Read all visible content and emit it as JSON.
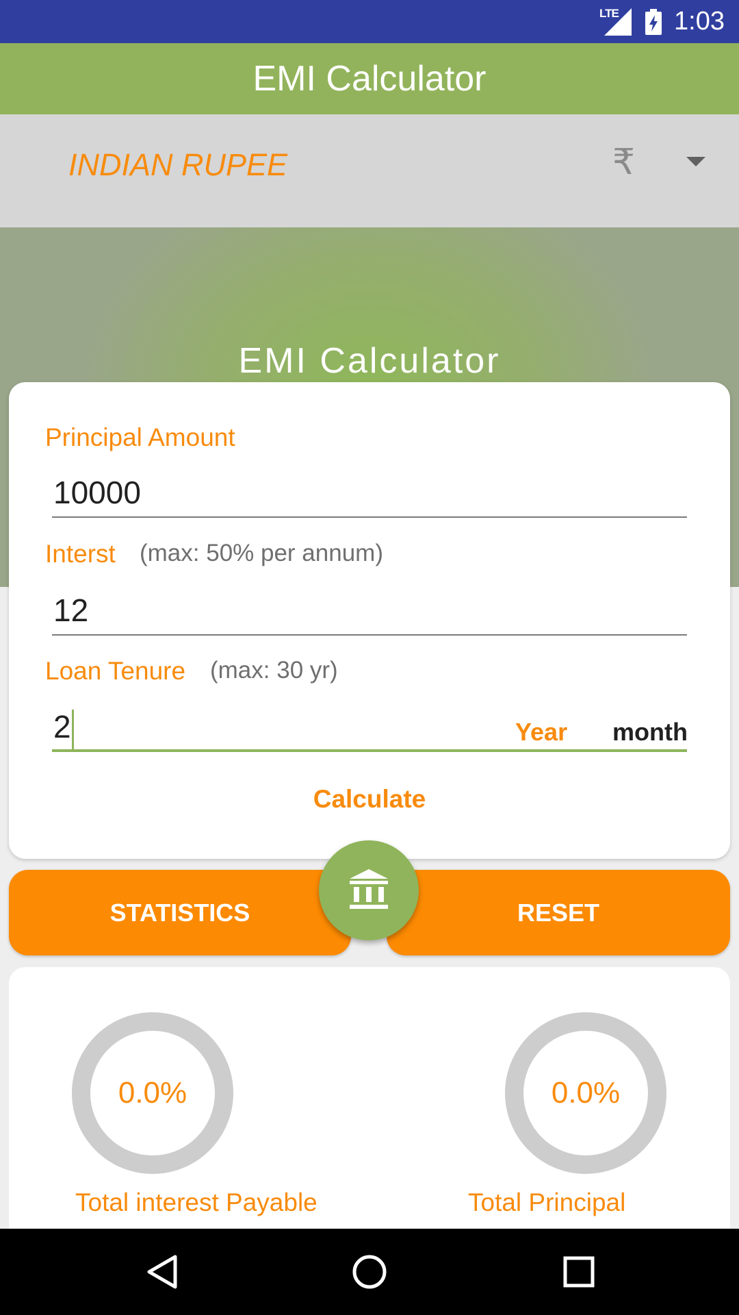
{
  "status_bar": {
    "network": "LTE",
    "time": "1:03"
  },
  "app_bar": {
    "title": "EMI Calculator"
  },
  "currency": {
    "name": "INDIAN RUPEE",
    "symbol": "₹"
  },
  "hero": {
    "title": "EMI Calculator"
  },
  "form": {
    "principal": {
      "label": "Principal Amount",
      "value": "10000"
    },
    "interest": {
      "label": "Interst",
      "hint": "(max: 50% per annum)",
      "value": "12"
    },
    "tenure": {
      "label": "Loan Tenure",
      "hint": "(max: 30 yr)",
      "value": "2",
      "unit_year": "Year",
      "unit_month": "month"
    },
    "calculate_label": "Calculate"
  },
  "actions": {
    "statistics_label": "STATISTICS",
    "reset_label": "RESET"
  },
  "stats": {
    "interest": {
      "percent": "0.0%",
      "label": "Total interest Payable"
    },
    "principal": {
      "percent": "0.0%",
      "label": "Total Principal"
    }
  },
  "colors": {
    "accent": "#f88b0d",
    "primary_green": "#92b35b",
    "button_orange": "#fc8a02",
    "status_bar": "#303f9f"
  },
  "icons": {
    "fab": "bank-icon",
    "nav": [
      "back-icon",
      "home-icon",
      "recents-icon"
    ]
  }
}
